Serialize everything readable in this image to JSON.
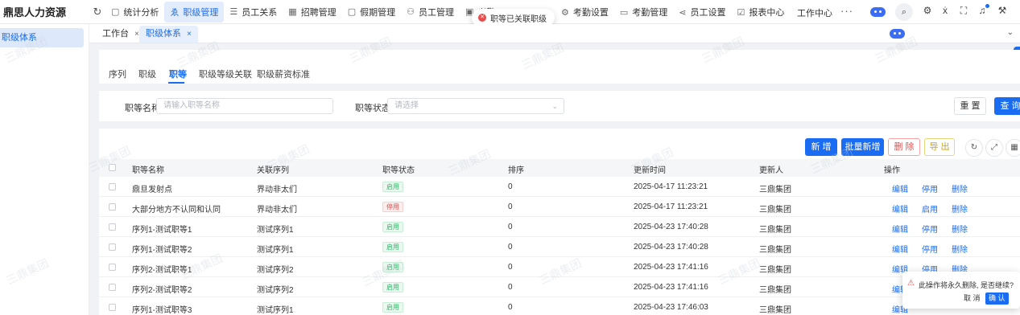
{
  "app": {
    "title": "鼎思人力资源"
  },
  "topnav": {
    "items": [
      {
        "label": "统计分析",
        "icon": "chart-icon",
        "glyph": "▢"
      },
      {
        "label": "职级管理",
        "icon": "hierarchy-icon",
        "glyph": "ゑ",
        "active": true
      },
      {
        "label": "员工关系",
        "icon": "list-icon",
        "glyph": "☰"
      },
      {
        "label": "招聘管理",
        "icon": "grid-icon",
        "glyph": "▦"
      },
      {
        "label": "假期管理",
        "icon": "document-icon",
        "glyph": "▢"
      },
      {
        "label": "员工管理",
        "icon": "users-icon",
        "glyph": "⚇"
      },
      {
        "label": "考勤",
        "icon": "id-card-icon",
        "glyph": "▣"
      }
    ],
    "right_items": [
      {
        "label": "考勤设置",
        "icon": "gear-icon",
        "glyph": "⚙"
      },
      {
        "label": "考勤管理",
        "icon": "card-icon",
        "glyph": "▭"
      },
      {
        "label": "员工设置",
        "icon": "share-icon",
        "glyph": "⋖"
      },
      {
        "label": "报表中心",
        "icon": "report-icon",
        "glyph": "☑"
      }
    ],
    "workcenter": "工作中心",
    "more": "···"
  },
  "toast": {
    "message": "职等已关联职级"
  },
  "sidebar": {
    "items": [
      {
        "label": "职级体系"
      }
    ]
  },
  "tabs": [
    {
      "label": "工作台",
      "close": "×"
    },
    {
      "label": "职级体系",
      "close": "×",
      "active": true
    }
  ],
  "subtabs": [
    "序列",
    "职级",
    "职等",
    "职级等级关联",
    "职级薪资标准"
  ],
  "subtab_active": "职等",
  "filter": {
    "name_label": "职等名称",
    "name_placeholder": "请输入职等名称",
    "status_label": "职等状态",
    "status_placeholder": "请选择",
    "reset": "重 置",
    "search": "查 询"
  },
  "toolbar": {
    "add": "新 增",
    "batch_add": "批量新增",
    "delete": "删 除",
    "export": "导 出"
  },
  "table": {
    "columns": [
      "职等名称",
      "关联序列",
      "职等状态",
      "排序",
      "更新时间",
      "更新人",
      "操作"
    ],
    "rows": [
      {
        "name": "鼎旦发射点",
        "seq": "界动非太们",
        "status": "启用",
        "on": true,
        "order": "0",
        "time": "2025-04-17 11:23:21",
        "user": "三鼎集团",
        "edit": "编辑",
        "toggle": "停用",
        "del": "删除"
      },
      {
        "name": "大部分地方不认同和认同",
        "seq": "界动非太们",
        "status": "停用",
        "on": false,
        "order": "0",
        "time": "2025-04-17 11:23:21",
        "user": "三鼎集团",
        "edit": "编辑",
        "toggle": "启用",
        "del": "删除"
      },
      {
        "name": "序列1-测试职等1",
        "seq": "测试序列1",
        "status": "启用",
        "on": true,
        "order": "0",
        "time": "2025-04-23 17:40:28",
        "user": "三鼎集团",
        "edit": "编辑",
        "toggle": "停用",
        "del": "删除"
      },
      {
        "name": "序列1-测试职等2",
        "seq": "测试序列1",
        "status": "启用",
        "on": true,
        "order": "0",
        "time": "2025-04-23 17:40:28",
        "user": "三鼎集团",
        "edit": "编辑",
        "toggle": "停用",
        "del": "删除"
      },
      {
        "name": "序列2-测试职等1",
        "seq": "测试序列2",
        "status": "启用",
        "on": true,
        "order": "0",
        "time": "2025-04-23 17:41:16",
        "user": "三鼎集团",
        "edit": "编辑",
        "toggle": "停用",
        "del": "删除"
      },
      {
        "name": "序列2-测试职等2",
        "seq": "测试序列2",
        "status": "启用",
        "on": true,
        "order": "0",
        "time": "2025-04-23 17:41:16",
        "user": "三鼎集团",
        "edit": "编辑",
        "toggle": "",
        "del": ""
      },
      {
        "name": "序列1-测试职等3",
        "seq": "测试序列1",
        "status": "启用",
        "on": true,
        "order": "0",
        "time": "2025-04-23 17:46:03",
        "user": "三鼎集团",
        "edit": "编辑",
        "toggle": "",
        "del": ""
      }
    ]
  },
  "popconfirm": {
    "message": "此操作将永久删除, 是否继续?",
    "cancel": "取 消",
    "confirm": "确 认"
  },
  "watermark": "三鼎集团",
  "colors": {
    "primary": "#1a6cf2",
    "danger": "#ea4b4b",
    "success": "#2fb567",
    "warning": "#d9a012"
  }
}
